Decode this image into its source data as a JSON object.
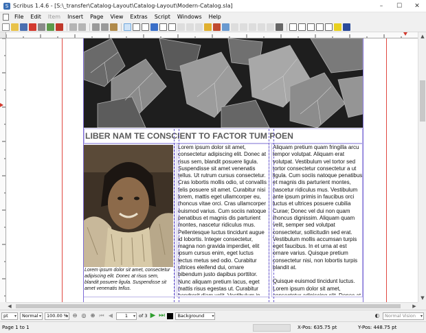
{
  "window": {
    "title": "Scribus 1.4.6 - [S:\\_transfer\\Catalog-Layout\\Catalog-Layout\\Modern-Catalog.sla]",
    "minimize": "–",
    "maximize": "☐",
    "close": "✕"
  },
  "menubar": {
    "items": [
      {
        "label": "File",
        "disabled": false
      },
      {
        "label": "Edit",
        "disabled": false
      },
      {
        "label": "Item",
        "disabled": true
      },
      {
        "label": "Insert",
        "disabled": false
      },
      {
        "label": "Page",
        "disabled": false
      },
      {
        "label": "View",
        "disabled": false
      },
      {
        "label": "Extras",
        "disabled": false
      },
      {
        "label": "Script",
        "disabled": false
      },
      {
        "label": "Windows",
        "disabled": false
      },
      {
        "label": "Help",
        "disabled": false
      }
    ]
  },
  "document": {
    "headline": "LIBER NAM TE CONSCIENT TO FACTOR TUM POEN",
    "caption": "Lorem ipsum dolor sit amet, consectetur adipiscing elit. Donec at risus sem, blandit posuere ligula. Suspendisse sit amet venenatis tellus.",
    "column1": "Lorem ipsum dolor sit amet, consectetur adipiscing elit. Donec at risus sem, blandit posuere ligula. Suspendisse sit amet venenatis tellus. Ut rutrum cursus consectetur. Cras lobortis mollis odio, ut convallis felis posuere sit amet. Curabitur nisi lorem, mattis eget ullamcorper eu, rhoncus vitae orci. Cras ullamcorper euismod varius. Cum sociis natoque penatibus et magnis dis parturient montes, nascetur ridiculus mus. Pellentesque luctus tincidunt augue id lobortis. Integer consectetur, magna non gravida imperdiet, elit ipsum cursus enim, eget luctus lectus metus sed odio. Curabitur ultrices eleifend dui, ornare bibendum justo dapibus porttitor. Nunc aliquam pretium lacus, eget mattis risus egestas ut. Curabitur hendrerit diam velit. Vestibulum in dui nibh. Maecenas feugiat feugiat sem a imperdiet.",
    "column2_p1": "Aliquam pretium quam fringilla arcu tempor volutpat. Aliquam erat volutpat. Vestibulum vel tortor sed tortor consectetur consectetur a ut ligula. Cum sociis natoque penatibus et magnis dis parturient montes, nascetur ridiculus mus. Vestibulum ante ipsum primis in faucibus orci luctus et ultrices posuere cubilia Curae; Donec vel dui non quam rhoncus dignissim. Aliquam quam velit, semper sed volutpat consectetur, sollicitudin sed erat. Vestibulum mollis accumsan turpis eget faucibus. In et urna at est ornare varius. Quisque pretium consectetur nisi, non lobortis turpis blandit at.",
    "column2_p2": "Quisque euismod tincidunt luctus. Lorem ipsum dolor sit amet, consectetur adipiscing elit. Donec at risus sem, blandit posuere ligula. Suspendisse sit amet venenatis"
  },
  "navbar": {
    "unit": "pt",
    "mode": "Normal",
    "zoom": "100.00 %",
    "page_number": "1",
    "page_of": "of 3",
    "layer": "Background",
    "view_mode": "Normal Vision"
  },
  "statusbar": {
    "page_info": "Page 1 to 1",
    "xpos_label": "X-Pos:",
    "xpos_value": "635.75 pt",
    "ypos_label": "Y-Pos:",
    "ypos_value": "448.75 pt"
  },
  "colors": {
    "guide_red": "#e0463f",
    "margin_purple": "#7c6bd6",
    "headline_gray": "#5a5a5a",
    "frame_outline": "#bcb5e8",
    "nav_green": "#2f9e2f"
  },
  "icons": {
    "toolbar": [
      "new-icon",
      "open-icon",
      "save-icon",
      "close-doc-icon",
      "print-icon",
      "preflight-icon",
      "pdf-icon",
      "undo-icon",
      "redo-icon",
      "cut-icon",
      "copy-icon",
      "paste-icon",
      "select-icon",
      "text-frame-icon",
      "image-frame-icon",
      "render-frame-icon",
      "table-icon",
      "shape-icon",
      "polygon-icon",
      "line-icon",
      "bezier-icon",
      "freehand-icon",
      "rotate-icon",
      "zoom-icon",
      "edit-contents-icon",
      "link-frames-icon",
      "unlink-frames-icon",
      "measure-icon",
      "copy-properties-icon",
      "eyedropper-icon",
      "pdf-button-icon",
      "pdf-field-icon",
      "pdf-checkbox-icon",
      "pdf-combo-icon",
      "pdf-list-icon",
      "pdf-annotation-icon",
      "pdf-link-icon"
    ]
  }
}
